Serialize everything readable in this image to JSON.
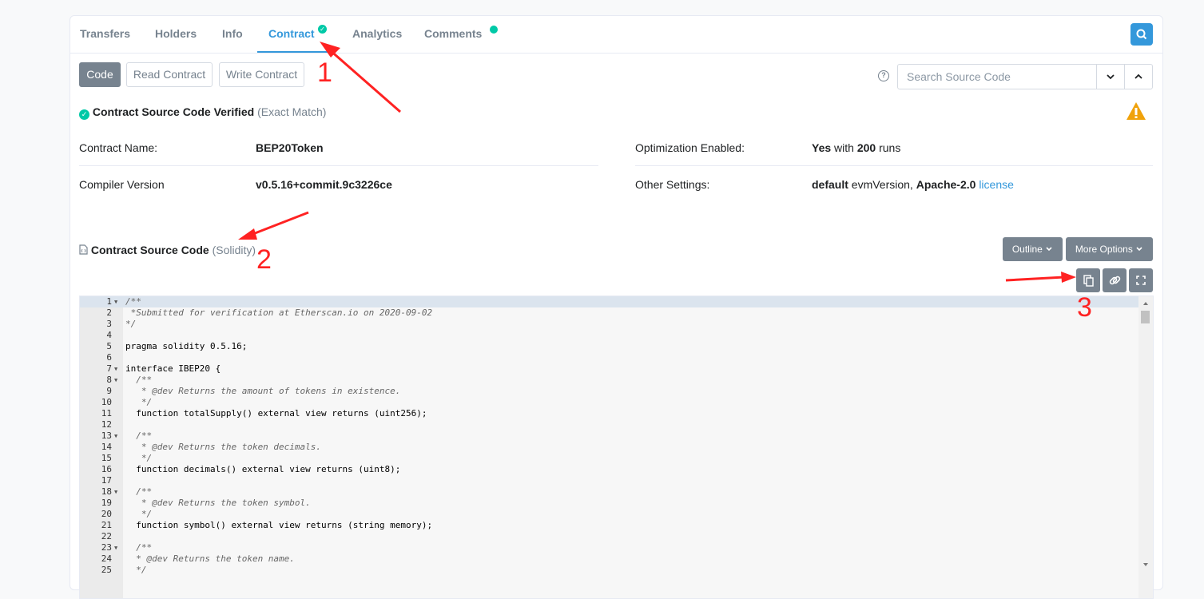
{
  "tabs": [
    {
      "label": "Transfers"
    },
    {
      "label": "Holders"
    },
    {
      "label": "Info"
    },
    {
      "label": "Contract"
    },
    {
      "label": "Analytics"
    },
    {
      "label": "Comments"
    }
  ],
  "toolbar": {
    "code_label": "Code",
    "read_label": "Read Contract",
    "write_label": "Write Contract",
    "search_placeholder": "Search Source Code"
  },
  "verified": {
    "title": "Contract Source Code Verified",
    "match": "(Exact Match)"
  },
  "details": {
    "name_label": "Contract Name:",
    "name_value": "BEP20Token",
    "compiler_label": "Compiler Version",
    "compiler_value": "v0.5.16+commit.9c3226ce",
    "optimization_label": "Optimization Enabled:",
    "optimization_yes": "Yes",
    "optimization_with": "with",
    "optimization_runs_count": "200",
    "optimization_runs": "runs",
    "settings_label": "Other Settings:",
    "settings_default": "default",
    "settings_evm": "evmVersion,",
    "settings_license_name": "Apache-2.0",
    "settings_license_link": "license"
  },
  "source": {
    "title": "Contract Source Code",
    "lang": "(Solidity)",
    "outline_label": "Outline",
    "more_label": "More Options"
  },
  "annotations": [
    "1",
    "2",
    "3"
  ],
  "code_lines": [
    {
      "n": "1",
      "text": "/**"
    },
    {
      "n": "2",
      "text": " *Submitted for verification at Etherscan.io on 2020-09-02"
    },
    {
      "n": "3",
      "text": "*/"
    },
    {
      "n": "4",
      "text": ""
    },
    {
      "n": "5",
      "text": "pragma solidity 0.5.16;"
    },
    {
      "n": "6",
      "text": ""
    },
    {
      "n": "7",
      "text": "interface IBEP20 {"
    },
    {
      "n": "8",
      "text": "  /**"
    },
    {
      "n": "9",
      "text": "   * @dev Returns the amount of tokens in existence."
    },
    {
      "n": "10",
      "text": "   */"
    },
    {
      "n": "11",
      "text": "  function totalSupply() external view returns (uint256);"
    },
    {
      "n": "12",
      "text": ""
    },
    {
      "n": "13",
      "text": "  /**"
    },
    {
      "n": "14",
      "text": "   * @dev Returns the token decimals."
    },
    {
      "n": "15",
      "text": "   */"
    },
    {
      "n": "16",
      "text": "  function decimals() external view returns (uint8);"
    },
    {
      "n": "17",
      "text": ""
    },
    {
      "n": "18",
      "text": "  /**"
    },
    {
      "n": "19",
      "text": "   * @dev Returns the token symbol."
    },
    {
      "n": "20",
      "text": "   */"
    },
    {
      "n": "21",
      "text": "  function symbol() external view returns (string memory);"
    },
    {
      "n": "22",
      "text": ""
    },
    {
      "n": "23",
      "text": "  /**"
    },
    {
      "n": "24",
      "text": "  * @dev Returns the token name."
    },
    {
      "n": "25",
      "text": "  */"
    }
  ]
}
